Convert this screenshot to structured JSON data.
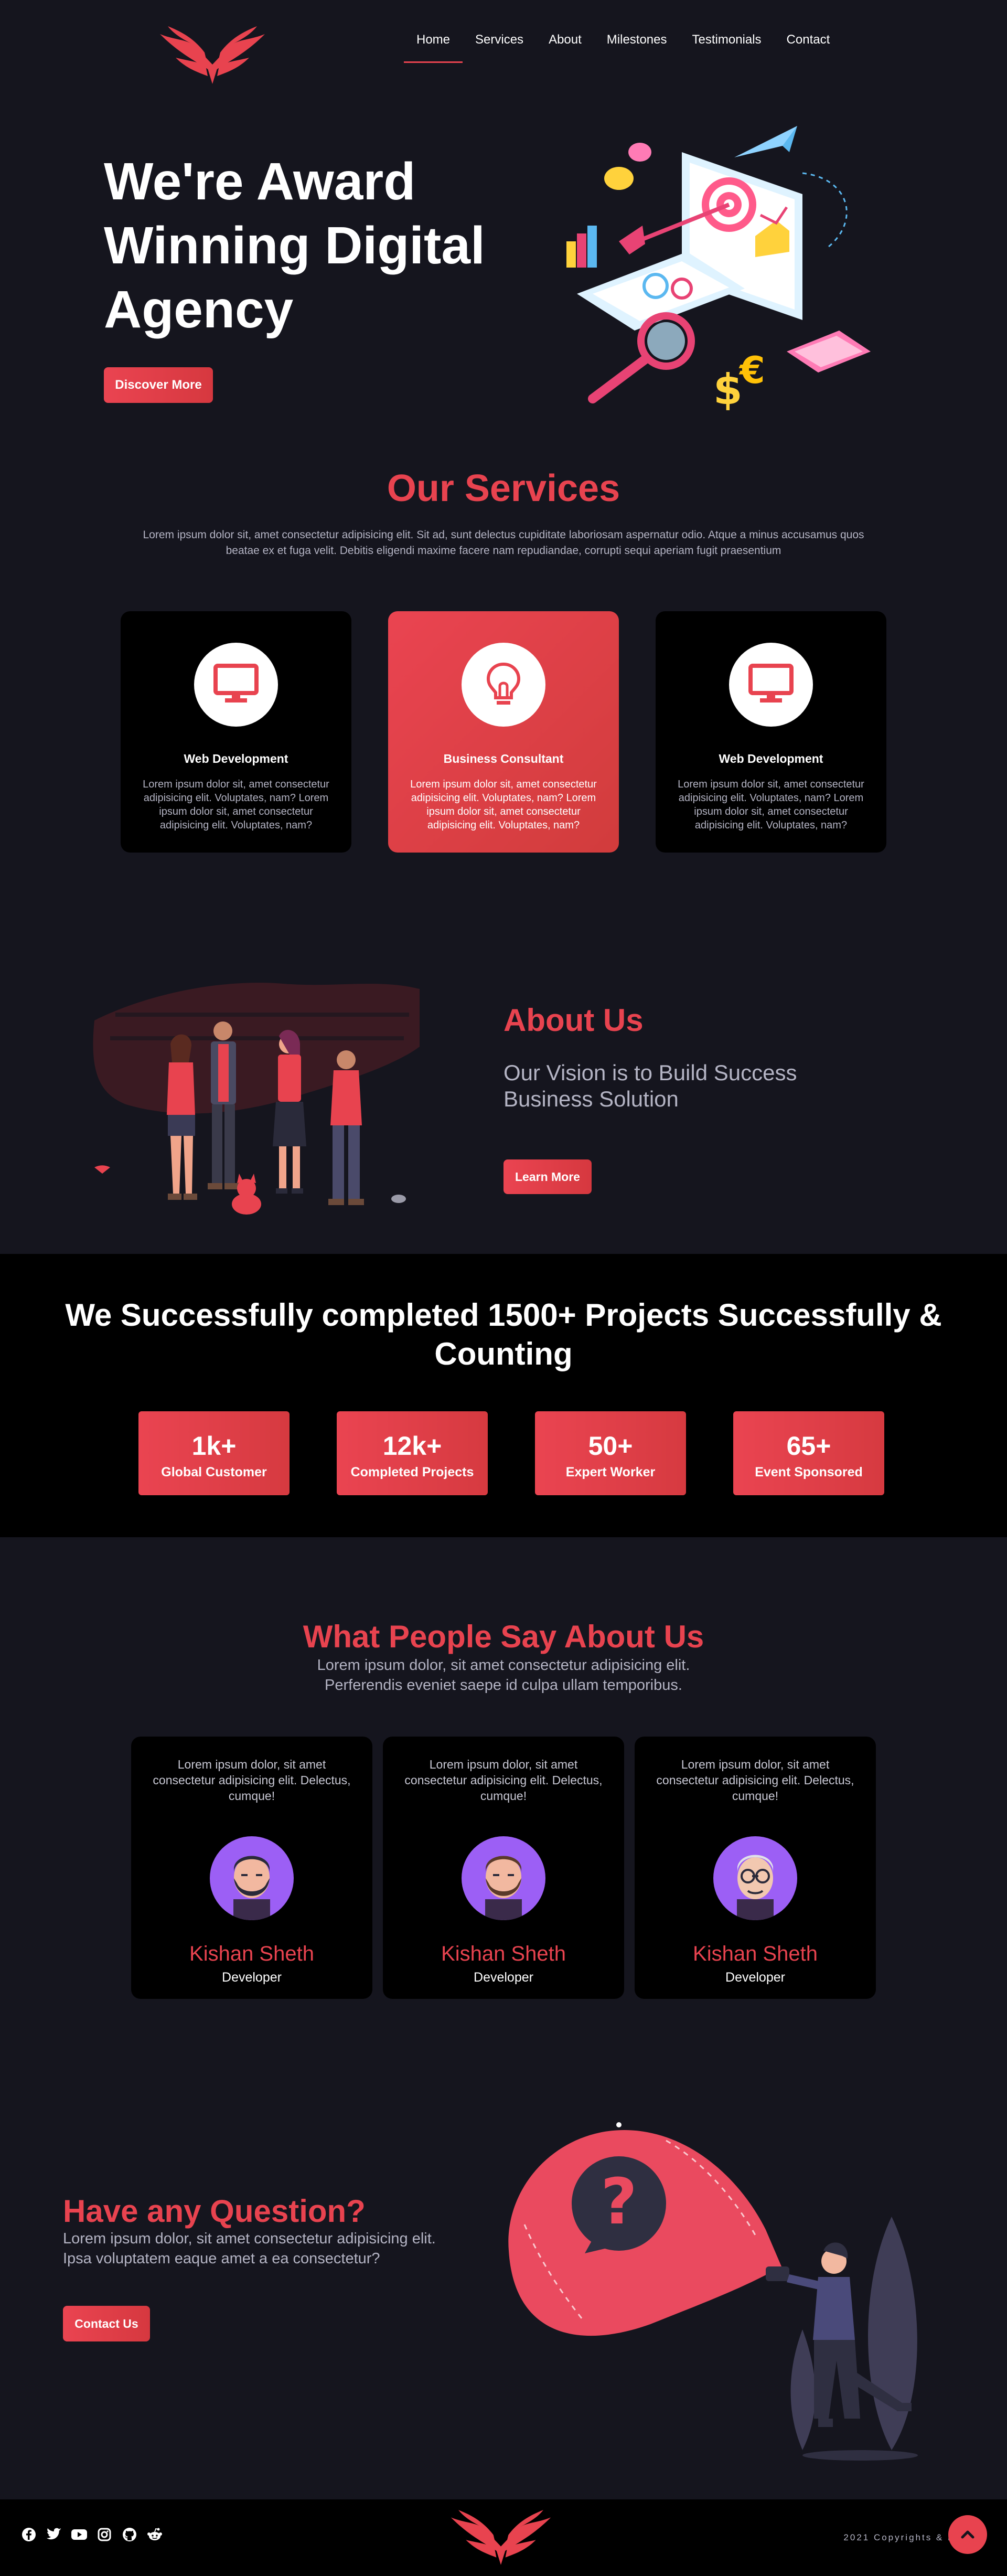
{
  "nav": {
    "logo_icon": "winged-logo-icon",
    "items": [
      {
        "label": "Home",
        "active": true
      },
      {
        "label": "Services"
      },
      {
        "label": "About"
      },
      {
        "label": "Milestones"
      },
      {
        "label": "Testimonials"
      },
      {
        "label": "Contact"
      }
    ]
  },
  "hero": {
    "title": "We're Award Winning Digital Agency",
    "button": "Discover More",
    "illustration": "digital-marketing-isometric-illustration"
  },
  "services": {
    "title": "Our Services",
    "description": "Lorem ipsum dolor sit, amet consectetur adipisicing elit. Sit ad, sunt delectus cupiditate laboriosam aspernatur odio. Atque a minus accusamus quos beatae ex et fuga velit. Debitis eligendi maxime facere nam repudiandae, corrupti sequi aperiam fugit praesentium",
    "cards": [
      {
        "icon": "monitor-icon",
        "title": "Web Development",
        "text": "Lorem ipsum dolor sit, amet consectetur adipisicing elit. Voluptates, nam? Lorem ipsum dolor sit, amet consectetur adipisicing elit. Voluptates, nam?"
      },
      {
        "icon": "lightbulb-icon",
        "title": "Business Consultant",
        "text": "Lorem ipsum dolor sit, amet consectetur adipisicing elit. Voluptates, nam? Lorem ipsum dolor sit, amet consectetur adipisicing elit. Voluptates, nam?"
      },
      {
        "icon": "monitor-icon",
        "title": "Web Development",
        "text": "Lorem ipsum dolor sit, amet consectetur adipisicing elit. Voluptates, nam? Lorem ipsum dolor sit, amet consectetur adipisicing elit. Voluptates, nam?"
      }
    ]
  },
  "about": {
    "title": "About Us",
    "subtitle": "Our Vision is to Build Success Business Solution",
    "button": "Learn More",
    "illustration": "team-group-illustration"
  },
  "stats": {
    "title": "We Successfully completed 1500+ Projects Successfully & Counting",
    "items": [
      {
        "value": "1k+",
        "label": "Global Customer"
      },
      {
        "value": "12k+",
        "label": "Completed Projects"
      },
      {
        "value": "50+",
        "label": "Expert Worker"
      },
      {
        "value": "65+",
        "label": "Event Sponsored"
      }
    ]
  },
  "testimonials": {
    "title": "What People Say About Us",
    "description": "Lorem ipsum dolor, sit amet consectetur adipisicing elit. Perferendis eveniet saepe id culpa ullam temporibus.",
    "cards": [
      {
        "quote": "Lorem ipsum dolor, sit amet consectetur adipisicing elit. Delectus, cumque!",
        "name": "Kishan Sheth",
        "role": "Developer",
        "avatar": "bearded-man-avatar-icon"
      },
      {
        "quote": "Lorem ipsum dolor, sit amet consectetur adipisicing elit. Delectus, cumque!",
        "name": "Kishan Sheth",
        "role": "Developer",
        "avatar": "bearded-man-avatar-icon"
      },
      {
        "quote": "Lorem ipsum dolor, sit amet consectetur adipisicing elit. Delectus, cumque!",
        "name": "Kishan Sheth",
        "role": "Developer",
        "avatar": "glasses-man-avatar-icon"
      }
    ]
  },
  "contact": {
    "title": "Have any Question?",
    "description": "Lorem ipsum dolor, sit amet consectetur adipisicing elit. Ipsa voluptatem eaque amet a ea consectetur?",
    "button": "Contact Us",
    "illustration": "question-flashlight-illustration"
  },
  "footer": {
    "socials": [
      "facebook-icon",
      "twitter-icon",
      "youtube-icon",
      "instagram-icon",
      "github-icon",
      "reddit-icon"
    ],
    "copyright": "2021 Copyrights & Pr",
    "to_top_icon": "arrow-up-icon"
  },
  "colors": {
    "accent": "#e8434f",
    "background": "#15151e",
    "card": "#000000",
    "muted_text": "#b4b4c4",
    "avatar_bg": "#9c5ff5"
  }
}
